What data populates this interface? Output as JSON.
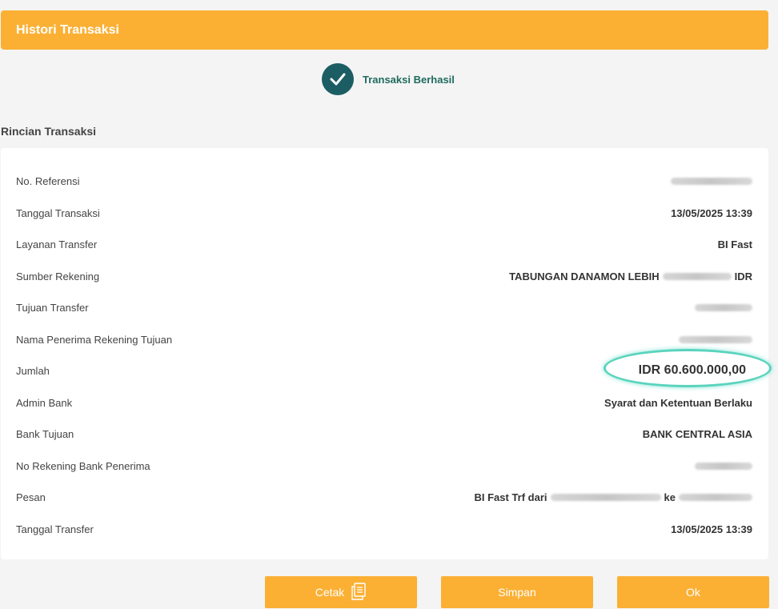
{
  "header": {
    "title": "Histori Transaksi"
  },
  "status": {
    "text": "Transaksi Berhasil",
    "icon": "check-icon"
  },
  "section_title": "Rincian Transaksi",
  "details": {
    "ref_label": "No. Referensi",
    "date_label": "Tanggal Transaksi",
    "date_value": "13/05/2025 13:39",
    "service_label": "Layanan Transfer",
    "service_value": "BI Fast",
    "source_label": "Sumber Rekening",
    "source_prefix": "TABUNGAN DANAMON LEBIH",
    "source_suffix": "IDR",
    "dest_label": "Tujuan Transfer",
    "recipient_label": "Nama Penerima Rekening Tujuan",
    "amount_label": "Jumlah",
    "amount_value": "IDR 60.600.000,00",
    "admin_label": "Admin Bank",
    "admin_value": "Syarat dan Ketentuan Berlaku",
    "bank_label": "Bank Tujuan",
    "bank_value": "BANK CENTRAL ASIA",
    "account_label": "No Rekening Bank Penerima",
    "message_label": "Pesan",
    "message_prefix": "BI Fast Trf dari",
    "message_mid": "ke",
    "transfer_date_label": "Tanggal Transfer",
    "transfer_date_value": "13/05/2025 13:39"
  },
  "buttons": {
    "print": "Cetak",
    "save": "Simpan",
    "ok": "Ok"
  },
  "colors": {
    "accent": "#fbb034",
    "success": "#1b5d63",
    "highlight_ring": "#5ad3bd"
  }
}
